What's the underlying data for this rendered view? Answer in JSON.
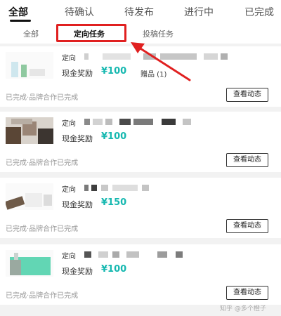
{
  "top_tabs": [
    "全部",
    "待确认",
    "待发布",
    "进行中",
    "已完成"
  ],
  "sub_tabs": [
    "全部",
    "定向任务",
    "投稿任务"
  ],
  "cards": [
    {
      "tag": "定向",
      "reward_label": "现金奖励",
      "reward_value": "¥100",
      "gift": "赠品 (1)",
      "status": "已完成·品牌合作已完成",
      "button": "查看动态"
    },
    {
      "tag": "定向",
      "reward_label": "现金奖励",
      "reward_value": "¥100",
      "status": "已完成·品牌合作已完成",
      "button": "查看动态"
    },
    {
      "tag": "定向",
      "reward_label": "现金奖励",
      "reward_value": "¥150",
      "status": "已完成·品牌合作已完成",
      "button": "查看动态"
    },
    {
      "tag": "定向",
      "reward_label": "现金奖励",
      "reward_value": "¥100",
      "status": "已完成·品牌合作已完成",
      "button": "查看动态"
    }
  ],
  "watermark": "知乎 @多个橙子",
  "colors": {
    "reward": "#16b8b0",
    "highlight": "#e02020"
  }
}
